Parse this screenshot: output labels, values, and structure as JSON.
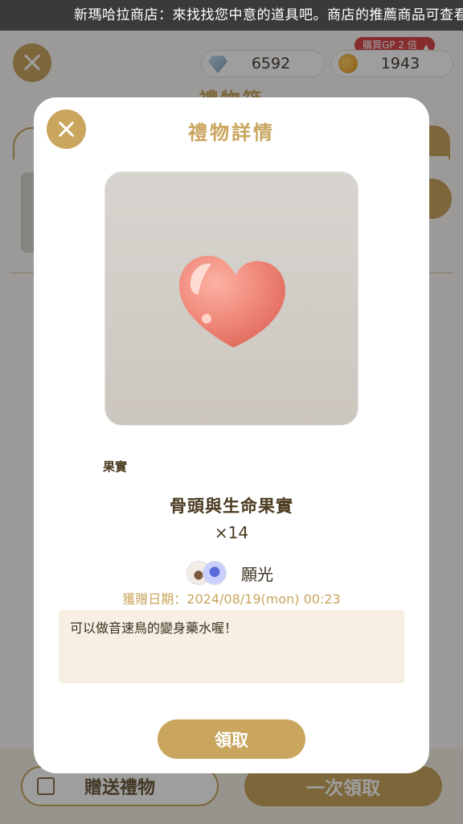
{
  "ticker": {
    "text": "新瑪哈拉商店：來找找您中意的道具吧。商店的推薦商品可查看"
  },
  "header": {
    "gems": "6592",
    "gold": "1943",
    "promo_badge": "購買GP 2 倍",
    "title": "禮物箱"
  },
  "footer": {
    "send_label": "贈送禮物",
    "receive_all_label": "一次領取"
  },
  "modal": {
    "title": "禮物詳情",
    "item_image": "heart-shaped-fruit",
    "category": "果實",
    "item_name": "骨頭與生命果實",
    "quantity": "×14",
    "sender_name": "願光",
    "date": "獲贈日期：2024/08/19(mon) 00:23",
    "message": "可以做音速鳥的變身藥水喔！",
    "claim_label": "領取"
  },
  "colors": {
    "accent": "#c9a55e",
    "text_dark": "#4a3a20",
    "message_bg": "#f7efe2"
  }
}
